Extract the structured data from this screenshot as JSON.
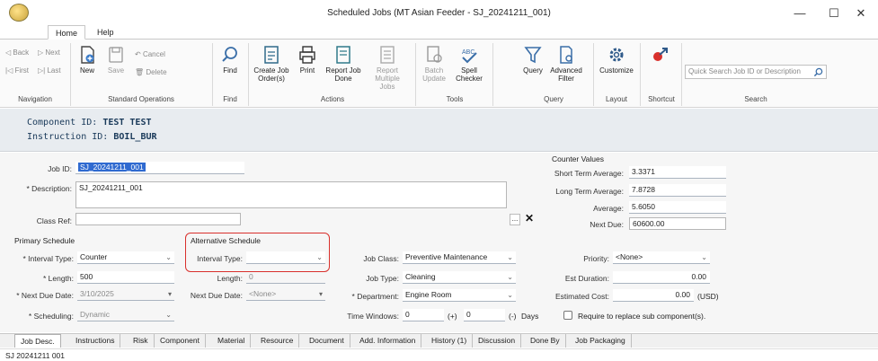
{
  "window": {
    "title": "Scheduled Jobs (MT Asian Feeder - SJ_20241211_001)",
    "minimize": "—",
    "maximize": "☐",
    "close": "✕"
  },
  "menu_tabs": [
    "Home",
    "Help"
  ],
  "ribbon": {
    "nav": {
      "back": "◁  Back",
      "next": "▷  Next",
      "first": "|◁  First",
      "last": "▷|  Last",
      "label": "Navigation"
    },
    "standard": {
      "new": "New",
      "save": "Save",
      "cancel": "Cancel",
      "delete": "Delete",
      "label": "Standard Operations"
    },
    "find": {
      "find": "Find",
      "label": "Find"
    },
    "actions": {
      "create": "Create Job Order(s)",
      "print": "Print",
      "report_done": "Report Job Done",
      "report_multi": "Report Multiple Jobs",
      "label": "Actions"
    },
    "tools": {
      "batch": "Batch Update",
      "spell": "Spell Checker",
      "label": "Tools"
    },
    "query": {
      "query": "Query",
      "advanced": "Advanced Filter",
      "label": "Query"
    },
    "layout": {
      "customize": "Customize",
      "label": "Layout"
    },
    "shortcut": {
      "label": "Shortcut"
    },
    "search": {
      "placeholder": "Quick Search Job ID or Description",
      "label": "Search"
    }
  },
  "header": {
    "component_label": "Component ID:",
    "component_value": "TEST TEST",
    "instruction_label": "Instruction ID:",
    "instruction_value": "BOIL_BUR"
  },
  "form": {
    "job_id_label": "Job ID:",
    "job_id_value": "SJ_20241211_001",
    "description_label": "* Description:",
    "description_value": "SJ_20241211_001",
    "class_ref_label": "Class Ref:",
    "class_ref_value": "",
    "ellipsis": "...",
    "clear": "✕",
    "counter": {
      "title": "Counter Values",
      "short_label": "Short Term Average:",
      "short_value": "3.3371",
      "long_label": "Long Term Average:",
      "long_value": "7.8728",
      "avg_label": "Average:",
      "avg_value": "5.6050",
      "next_label": "Next Due:",
      "next_value": "60600.00"
    },
    "primary": {
      "title": "Primary Schedule",
      "interval_label": "* Interval Type:",
      "interval_value": "Counter",
      "length_label": "* Length:",
      "length_value": "500",
      "next_due_label": "* Next Due Date:",
      "next_due_value": "3/10/2025",
      "scheduling_label": "* Scheduling:",
      "scheduling_value": "Dynamic"
    },
    "alternative": {
      "title": "Alternative Schedule",
      "interval_label": "Interval Type:",
      "interval_value": "",
      "length_label": "Length:",
      "length_value": "0",
      "next_due_label": "Next Due Date:",
      "next_due_value": "<None>"
    },
    "job": {
      "class_label": "Job Class:",
      "class_value": "Preventive Maintenance",
      "type_label": "Job Type:",
      "type_value": "Cleaning",
      "dept_label": "* Department:",
      "dept_value": "Engine Room",
      "tw_label": "Time Windows:",
      "tw_minus_value": "0",
      "tw_plus": "(+)",
      "tw_plus_value": "0",
      "tw_minus": "(-)",
      "tw_days": "Days"
    },
    "right": {
      "priority_label": "Priority:",
      "priority_value": "<None>",
      "duration_label": "Est Duration:",
      "duration_value": "0.00",
      "cost_label": "Estimated Cost:",
      "cost_value": "0.00",
      "cost_unit": "(USD)",
      "replace_label": "Require to replace sub component(s)."
    }
  },
  "bottom_tabs": [
    "Job Desc.",
    "Instructions",
    "Risk",
    "Component",
    "Material",
    "Resource",
    "Document",
    "Add. Information",
    "History (1)",
    "Discussion",
    "Done By",
    "Job Packaging"
  ],
  "status_text": "SJ 20241211 001",
  "colors": {
    "accent_red": "#d9302c",
    "link_blue": "#1f5aa6",
    "header_band": "#e8ecf0"
  }
}
